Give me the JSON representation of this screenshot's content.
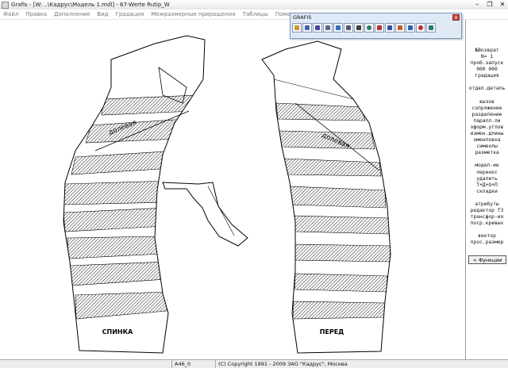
{
  "window": {
    "title": "Grafis - [W: ..\\Кадрус\\Модель 1.mdl] - 67-Werte Rutip_W"
  },
  "menu": [
    "Файл",
    "Правка",
    "Дополнение",
    "Вид",
    "Градация",
    "Межразмерные приращения",
    "Таблицы",
    "Помощь"
  ],
  "toolbox": {
    "title": "GRAFIS",
    "tools": [
      "open-icon",
      "print-icon",
      "save-icon",
      "search-icon",
      "user-icon",
      "layers-icon",
      "ruler-icon",
      "globe-icon",
      "delete-x-icon",
      "grade-icon",
      "download-icon",
      "arrow-down-icon",
      "stop-icon",
      "exit-icon"
    ]
  },
  "right_panel": {
    "groups": [
      [
        "№Возврат",
        "N= 1",
        "проб.запуск",
        "000 000",
        "градация"
      ],
      [
        "отдел.деталь"
      ],
      [
        "вызов",
        "сопряжение",
        "разделение",
        "паралл.ли",
        "оформ.углов",
        "измен.длины",
        "оменловка",
        "символы",
        "разметка"
      ],
      [
        "модел-ие",
        "перенос",
        "удалить",
        "T+Д+О+П",
        "складки"
      ],
      [
        "атрибуты",
        "редактор ТЗ",
        "трансфор-ия",
        "поср.кривых"
      ],
      [
        "вектор",
        "прос.размер"
      ]
    ],
    "function_button": "< Функции"
  },
  "drawing": {
    "left_piece_label": "СПИНКА",
    "right_piece_label": "ПЕРЕД",
    "left_grain_label": "долевая",
    "right_grain_label": "долевая"
  },
  "status": {
    "code": "A46_0",
    "copyright": "(C) Copyright 1991 - 2009 ЗАО \"Кадрус\", Москва"
  }
}
